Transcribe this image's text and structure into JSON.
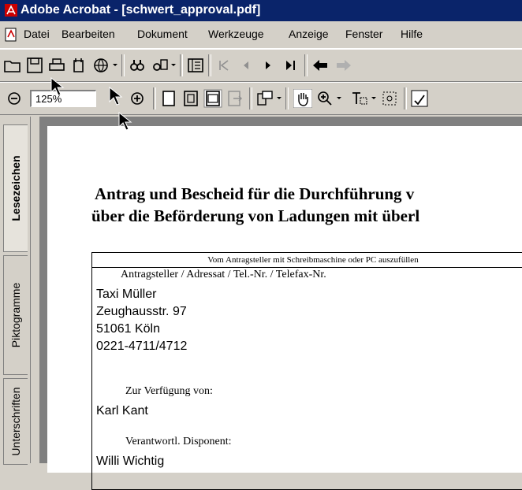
{
  "window": {
    "title": "Adobe Acrobat - [schwert_approval.pdf]"
  },
  "menu": [
    "Datei",
    "Bearbeiten",
    "Dokument",
    "Werkzeuge",
    "Anzeige",
    "Fenster",
    "Hilfe"
  ],
  "toolbar2": {
    "zoom_value": "125%"
  },
  "side_tabs": [
    "Lesezeichen",
    "Piktogramme",
    "Unterschriften"
  ],
  "document": {
    "title_line1": "Antrag und Bescheid für die Durchführung v",
    "title_line2": "über die Beförderung von Ladungen mit überl",
    "form_header": "Vom Antragsteller mit Schreibmaschine oder PC auszufüllen",
    "applicant_label": "Antragsteller / Adressat / Tel.-Nr. / Telefax-Nr.",
    "applicant_lines": [
      "Taxi Müller",
      "Zeughausstr. 97",
      "51061 Köln",
      "0221-4711/4712"
    ],
    "available_label": "Zur Verfügung von:",
    "available_value": "Karl Kant",
    "dispatcher_label": "Verantwortl. Disponent:",
    "dispatcher_value": "Willi Wichtig"
  }
}
